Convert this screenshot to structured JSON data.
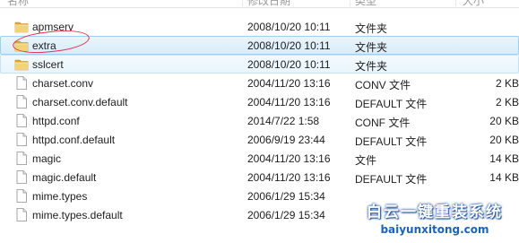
{
  "header": {
    "columns": [
      {
        "name": "name",
        "label": "名称"
      },
      {
        "name": "date",
        "label": "修改日期"
      },
      {
        "name": "type",
        "label": "类型"
      },
      {
        "name": "size",
        "label": "大小"
      }
    ]
  },
  "files": [
    {
      "name": "apmserv",
      "date": "2008/10/20 10:11",
      "type": "文件夹",
      "size": "",
      "icon": "folder-icon",
      "state": ""
    },
    {
      "name": "extra",
      "date": "2008/10/20 10:11",
      "type": "文件夹",
      "size": "",
      "icon": "folder-icon",
      "state": "selected"
    },
    {
      "name": "sslcert",
      "date": "2008/10/20 10:11",
      "type": "文件夹",
      "size": "",
      "icon": "folder-icon",
      "state": "hover"
    },
    {
      "name": "charset.conv",
      "date": "2004/11/20 13:16",
      "type": "CONV 文件",
      "size": "2 KB",
      "icon": "file-icon",
      "state": ""
    },
    {
      "name": "charset.conv.default",
      "date": "2004/11/20 13:16",
      "type": "DEFAULT 文件",
      "size": "2 KB",
      "icon": "file-icon",
      "state": ""
    },
    {
      "name": "httpd.conf",
      "date": "2014/7/22 1:58",
      "type": "CONF 文件",
      "size": "20 KB",
      "icon": "file-icon",
      "state": ""
    },
    {
      "name": "httpd.conf.default",
      "date": "2006/9/19 23:44",
      "type": "DEFAULT 文件",
      "size": "20 KB",
      "icon": "file-icon",
      "state": ""
    },
    {
      "name": "magic",
      "date": "2004/11/20 13:16",
      "type": "文件",
      "size": "14 KB",
      "icon": "file-icon",
      "state": ""
    },
    {
      "name": "magic.default",
      "date": "2004/11/20 13:16",
      "type": "DEFAULT 文件",
      "size": "14 KB",
      "icon": "file-icon",
      "state": ""
    },
    {
      "name": "mime.types",
      "date": "2006/1/29 15:34",
      "type": "",
      "size": "",
      "icon": "file-icon",
      "state": ""
    },
    {
      "name": "mime.types.default",
      "date": "2006/1/29 15:34",
      "type": "",
      "size": "",
      "icon": "file-icon",
      "state": ""
    }
  ],
  "watermark": {
    "title": "白云一键重装系统",
    "url": "baiyunxitong.com"
  },
  "colors": {
    "selection": "#d6ecfb",
    "selection_border": "#9fd0f4",
    "annotation": "#e0304a",
    "folder": "#e8c35a"
  }
}
